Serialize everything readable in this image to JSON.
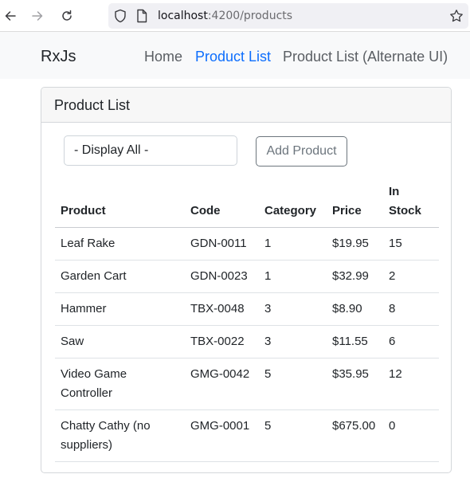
{
  "browser": {
    "url_host": "localhost",
    "url_rest": ":4200/products"
  },
  "app_nav": {
    "brand": "RxJs",
    "links": [
      {
        "label": "Home",
        "active": false
      },
      {
        "label": "Product List",
        "active": true
      },
      {
        "label": "Product List (Alternate UI)",
        "active": false
      }
    ]
  },
  "card": {
    "title": "Product List",
    "filter": {
      "selected": "- Display All -"
    },
    "add_button": "Add Product",
    "table": {
      "headers": [
        "Product",
        "Code",
        "Category",
        "Price",
        "In Stock"
      ],
      "rows": [
        [
          "Leaf Rake",
          "GDN-0011",
          "1",
          "$19.95",
          "15"
        ],
        [
          "Garden Cart",
          "GDN-0023",
          "1",
          "$32.99",
          "2"
        ],
        [
          "Hammer",
          "TBX-0048",
          "3",
          "$8.90",
          "8"
        ],
        [
          "Saw",
          "TBX-0022",
          "3",
          "$11.55",
          "6"
        ],
        [
          "Video Game Controller",
          "GMG-0042",
          "5",
          "$35.95",
          "12"
        ],
        [
          "Chatty Cathy (no suppliers)",
          "GMG-0001",
          "5",
          "$675.00",
          "0"
        ]
      ]
    }
  },
  "colors": {
    "active_link": "#0d6efd",
    "nav_background": "#f8f9fa",
    "button_outline": "#6c757d"
  },
  "icons": [
    "back-arrow-icon",
    "forward-arrow-icon",
    "reload-icon",
    "shield-icon",
    "page-icon",
    "bookmark-star-icon"
  ]
}
